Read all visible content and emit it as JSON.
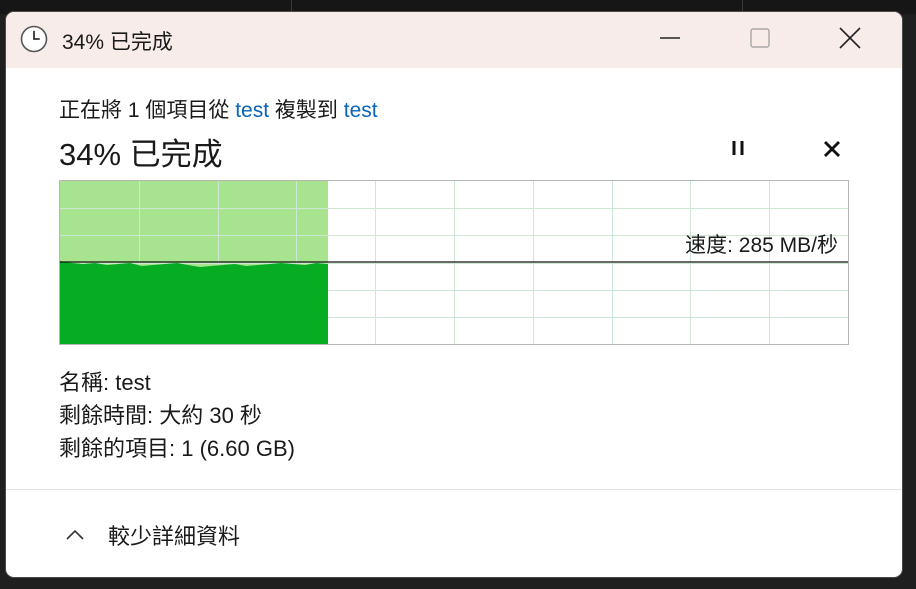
{
  "window": {
    "title": "34% 已完成",
    "icon": "clock-icon"
  },
  "controls": {
    "minimize": "minimize-icon",
    "maximize": "maximize-icon",
    "close": "close-icon"
  },
  "header": {
    "prefix": "正在將 1 個項目從",
    "source": "test",
    "middle": "複製到",
    "destination": "test"
  },
  "progress": {
    "title": "34% 已完成",
    "percent": 34,
    "pause_icon": "pause-icon",
    "cancel_icon": "cancel-icon"
  },
  "graph": {
    "speed_label": "速度: 285 MB/秒",
    "colors": {
      "filled_area": "#06ad23",
      "upper_area": "#a8e390",
      "grid": "#cfe8d5",
      "speed_line": "#111111"
    }
  },
  "details": {
    "name": "名稱:  test",
    "time_left": "剩餘時間:  大約 30 秒",
    "items_left": "剩餘的項目:  1 (6.60 GB)"
  },
  "footer": {
    "toggle_label": "較少詳細資料",
    "toggle_icon": "chevron-up-icon"
  }
}
